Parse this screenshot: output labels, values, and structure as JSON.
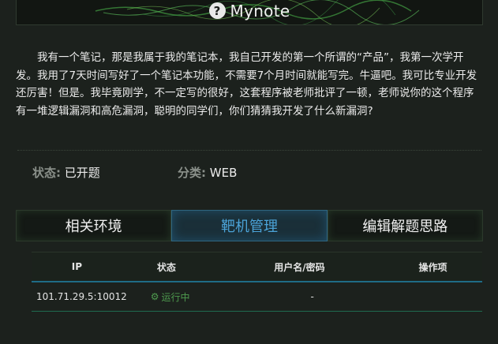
{
  "header": {
    "title": "Mynote"
  },
  "description": "我有一个笔记，那是我属于我的笔记本，我自己开发的第一个所谓的“产品”，我第一次学开发。我用了7天时间写好了一个笔记本功能，不需要7个月时间就能写完。牛逼吧。我可比专业开发还厉害！但是。我毕竟刚学，不一定写的很好，这套程序被老师批评了一顿，老师说你的这个程序有一堆逻辑漏洞和高危漏洞，聪明的同学们，你们猜猜我开发了什么新漏洞?",
  "meta": {
    "status_label": "状态:",
    "status_value": "已开题",
    "category_label": "分类:",
    "category_value": "WEB"
  },
  "tabs": [
    {
      "label": "相关环境",
      "active": false
    },
    {
      "label": "靶机管理",
      "active": true
    },
    {
      "label": "编辑解题思路",
      "active": false
    }
  ],
  "table": {
    "headers": [
      "IP",
      "状态",
      "用户名/密码",
      "操作项"
    ],
    "rows": [
      {
        "ip": "101.71.29.5:10012",
        "status": "运行中",
        "credentials": "-",
        "action": ""
      }
    ]
  },
  "colors": {
    "background": "#1c211d",
    "active_tab": "#4ba3d8",
    "running_status": "#4e9a4e",
    "table_accent": "#1f6b86"
  },
  "icons": {
    "title_icon": "question-circle-icon",
    "status_icon": "gear-icon"
  }
}
